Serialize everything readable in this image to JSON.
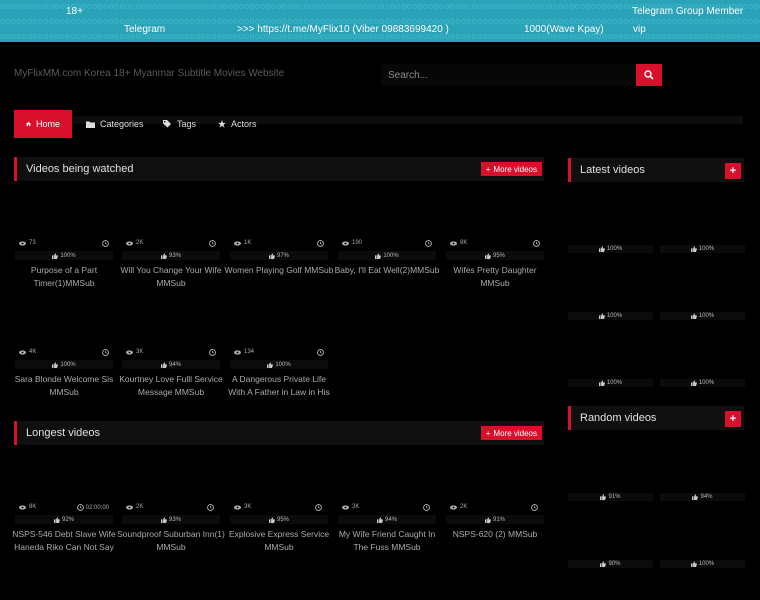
{
  "topbar": {
    "line1_left": "18+",
    "line1_right": "Telegram Group Member",
    "line2_left": "Telegram",
    "line2_link": ">>> https://t.me/MyFlix10 (Viber 09883699420 )",
    "line2_mid": "1000(Wave Kpay)",
    "line2_right": "vip",
    "pattern": "oooooooooooooooooooooooooooooooooooooooooooooooooooooooooooooooooooooooooooooooooooooooooooooooooooooooooooooooooooooooooooooooooooooooooooooooooooooooooooooooooooooooooooooooooooooooooooooooooooooooo"
  },
  "header": {
    "site_title": "MyFlixMM.com Korea 18+ Myanmar Subtitle Movies Website",
    "search_placeholder": "Search..."
  },
  "nav": [
    {
      "label": "Home",
      "icon": "home-icon"
    },
    {
      "label": "Categories",
      "icon": "folder-icon"
    },
    {
      "label": "Tags",
      "icon": "tag-icon"
    },
    {
      "label": "Actors",
      "icon": "star-icon"
    }
  ],
  "watched": {
    "title": "Videos being watched",
    "more": "More videos",
    "items": [
      {
        "views": "73",
        "rating": "100%",
        "title": "Purpose of a Part Timer(1)MMSub"
      },
      {
        "views": "2K",
        "rating": "93%",
        "title": "Will You Change Your Wife MMSub"
      },
      {
        "views": "1K",
        "rating": "97%",
        "title": "Women Playing Golf MMSub"
      },
      {
        "views": "190",
        "rating": "100%",
        "title": "Baby, I'll Eat Well(2)MMSub"
      },
      {
        "views": "8K",
        "rating": "95%",
        "title": "Wifes Pretty Daughter MMSub"
      },
      {
        "views": "4K",
        "rating": "100%",
        "title": "Sara Blonde Welcome Sis MMSub"
      },
      {
        "views": "3K",
        "rating": "94%",
        "title": "Kourtney Love Fulll Service Message MMSub"
      },
      {
        "views": "134",
        "rating": "100%",
        "title": "A Dangerous Private Life With A Father in Law in His"
      }
    ]
  },
  "longest": {
    "title": "Longest videos",
    "more": "More videos",
    "items": [
      {
        "views": "8K",
        "duration": "02:00:00",
        "rating": "92%",
        "title": "NSPS-546 Debt Slave Wife Haneda Riko Can Not Say"
      },
      {
        "views": "2K",
        "duration": "",
        "rating": "93%",
        "title": "Soundproof Suburban Inn(1) MMSub"
      },
      {
        "views": "3K",
        "duration": "",
        "rating": "95%",
        "title": "Explosive Express Service MMSub"
      },
      {
        "views": "3K",
        "duration": "",
        "rating": "94%",
        "title": "My Wife Friend Caught In The Fuss MMSub"
      },
      {
        "views": "2K",
        "duration": "",
        "rating": "91%",
        "title": "NSPS-620 (2) MMSub"
      }
    ]
  },
  "latest": {
    "title": "Latest videos",
    "ratings": [
      "100%",
      "100%",
      "100%",
      "100%",
      "100%",
      "100%"
    ]
  },
  "random": {
    "title": "Random videos",
    "ratings": [
      "91%",
      "94%",
      "90%",
      "100%"
    ]
  },
  "colors": {
    "accent": "#d8102b",
    "topbar": "#2aa3b8",
    "background": "#000000"
  }
}
